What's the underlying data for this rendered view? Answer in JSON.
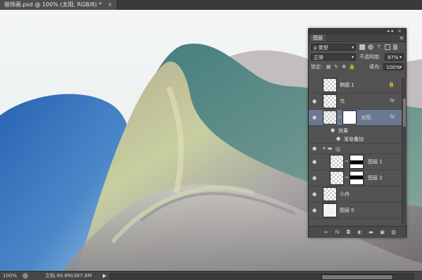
{
  "document": {
    "tab_title": "装饰画.psd @ 100% (太阳, RGB/8) *",
    "close_symbol": "×"
  },
  "status": {
    "zoom": "100%",
    "doc_info": "文档:99.8M/387.8M",
    "play_symbol": "▶"
  },
  "panel": {
    "tab_label": "图层",
    "menu_symbol": "≡",
    "header_controls": "◂◂ ×",
    "filter_kind": "ρ 类型",
    "blend_mode": "正常",
    "opacity_label": "不透明度:",
    "opacity_value": "87%",
    "lock_label": "锁定:",
    "fill_label": "填充:",
    "fill_value": "100%",
    "effects_label": "效果",
    "effect_item": "渐变叠加",
    "layers": [
      {
        "name": "椭圆 1",
        "visible": false,
        "locked": true
      },
      {
        "name": "鸟",
        "visible": true,
        "fx": "fx"
      },
      {
        "name": "太阳",
        "visible": true,
        "fx": "fx",
        "selected": true
      },
      {
        "name": "山",
        "visible": true,
        "group": true
      },
      {
        "name": "图层 1",
        "visible": true
      },
      {
        "name": "图层 2",
        "visible": true
      },
      {
        "name": "小舟",
        "visible": true
      },
      {
        "name": "图层 0",
        "visible": true
      }
    ]
  },
  "colors": {
    "selected_layer": "#6b7891",
    "panel_bg": "#535353",
    "sky": "#f2f4f4",
    "blue_hill": "#2f6cb8",
    "teal": "#3e7a78"
  }
}
